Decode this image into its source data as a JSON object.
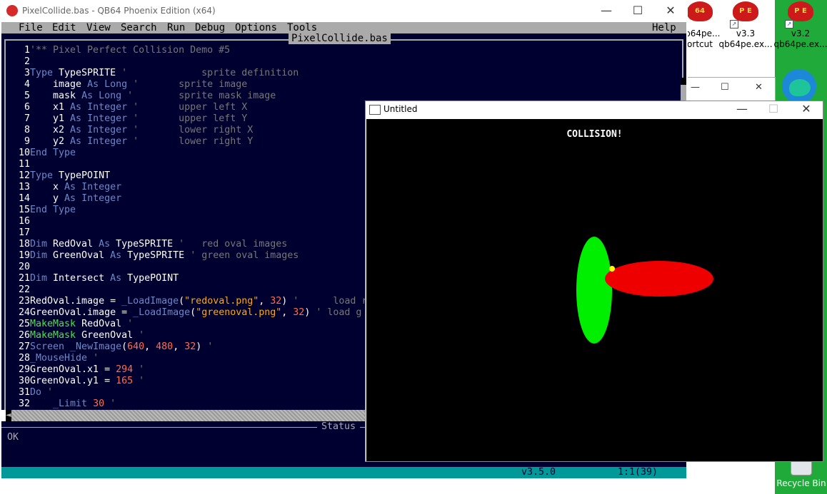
{
  "desktop": {
    "icons": [
      {
        "label_line1": "qb64pe...",
        "label_line2": "ortcut",
        "logo_text": "64"
      },
      {
        "label_line1": "v3.3",
        "label_line2": "qb64pe.ex...",
        "logo_text": "P E"
      },
      {
        "label_line1": "v3.2",
        "label_line2": "qb64pe.ex...",
        "logo_text": "P E"
      }
    ],
    "recycle_bin_label": "Recycle Bin"
  },
  "ide": {
    "window_title": "PixelCollide.bas - QB64 Phoenix Edition (x64)",
    "controls": {
      "minimize": "—",
      "maximize": "☐",
      "close": "✕"
    },
    "menu": [
      "File",
      "Edit",
      "View",
      "Search",
      "Run",
      "Debug",
      "Options",
      "Tools"
    ],
    "menu_help": "Help",
    "file_tab": "PixelCollide.bas",
    "status_label": "Status",
    "status_text": "OK",
    "version": "v3.5.0",
    "cursor_pos": "1:1(39)"
  },
  "code_lines": [
    [
      {
        "t": "'** Pixel Perfect Collision Demo #5",
        "c": "cm"
      }
    ],
    [],
    [
      {
        "t": "Type ",
        "c": "kw"
      },
      {
        "t": "TypeSPRITE ",
        "c": "id"
      },
      {
        "t": "'             sprite definition",
        "c": "cm"
      }
    ],
    [
      {
        "t": "    image ",
        "c": "id"
      },
      {
        "t": "As Long ",
        "c": "kw"
      },
      {
        "t": "'       sprite image",
        "c": "cm"
      }
    ],
    [
      {
        "t": "    mask ",
        "c": "id"
      },
      {
        "t": "As Long ",
        "c": "kw"
      },
      {
        "t": "'        sprite mask image",
        "c": "cm"
      }
    ],
    [
      {
        "t": "    x1 ",
        "c": "id"
      },
      {
        "t": "As Integer ",
        "c": "kw"
      },
      {
        "t": "'       upper left X",
        "c": "cm"
      }
    ],
    [
      {
        "t": "    y1 ",
        "c": "id"
      },
      {
        "t": "As Integer ",
        "c": "kw"
      },
      {
        "t": "'       upper left Y",
        "c": "cm"
      }
    ],
    [
      {
        "t": "    x2 ",
        "c": "id"
      },
      {
        "t": "As Integer ",
        "c": "kw"
      },
      {
        "t": "'       lower right X",
        "c": "cm"
      }
    ],
    [
      {
        "t": "    y2 ",
        "c": "id"
      },
      {
        "t": "As Integer ",
        "c": "kw"
      },
      {
        "t": "'       lower right Y",
        "c": "cm"
      }
    ],
    [
      {
        "t": "End Type",
        "c": "kw"
      }
    ],
    [],
    [
      {
        "t": "Type ",
        "c": "kw"
      },
      {
        "t": "TypePOINT",
        "c": "id"
      }
    ],
    [
      {
        "t": "    x ",
        "c": "id"
      },
      {
        "t": "As Integer",
        "c": "kw"
      }
    ],
    [
      {
        "t": "    y ",
        "c": "id"
      },
      {
        "t": "As Integer",
        "c": "kw"
      }
    ],
    [
      {
        "t": "End Type",
        "c": "kw"
      }
    ],
    [],
    [],
    [
      {
        "t": "Dim ",
        "c": "kw"
      },
      {
        "t": "RedOval ",
        "c": "id"
      },
      {
        "t": "As ",
        "c": "kw"
      },
      {
        "t": "TypeSPRITE ",
        "c": "id"
      },
      {
        "t": "'   red oval images",
        "c": "cm"
      }
    ],
    [
      {
        "t": "Dim ",
        "c": "kw"
      },
      {
        "t": "GreenOval ",
        "c": "id"
      },
      {
        "t": "As ",
        "c": "kw"
      },
      {
        "t": "TypeSPRITE ",
        "c": "id"
      },
      {
        "t": "' green oval images",
        "c": "cm"
      }
    ],
    [],
    [
      {
        "t": "Dim ",
        "c": "kw"
      },
      {
        "t": "Intersect ",
        "c": "id"
      },
      {
        "t": "As ",
        "c": "kw"
      },
      {
        "t": "TypePOINT",
        "c": "id"
      }
    ],
    [],
    [
      {
        "t": "RedOval.image = ",
        "c": "id"
      },
      {
        "t": "_LoadImage",
        "c": "kw"
      },
      {
        "t": "(",
        "c": "id"
      },
      {
        "t": "\"redoval.png\"",
        "c": "str"
      },
      {
        "t": ", ",
        "c": "id"
      },
      {
        "t": "32",
        "c": "nm"
      },
      {
        "t": ") ",
        "c": "id"
      },
      {
        "t": "'      load r",
        "c": "cm"
      }
    ],
    [
      {
        "t": "GreenOval.image = ",
        "c": "id"
      },
      {
        "t": "_LoadImage",
        "c": "kw"
      },
      {
        "t": "(",
        "c": "id"
      },
      {
        "t": "\"greenoval.png\"",
        "c": "str"
      },
      {
        "t": ", ",
        "c": "id"
      },
      {
        "t": "32",
        "c": "nm"
      },
      {
        "t": ") ",
        "c": "id"
      },
      {
        "t": "' load g",
        "c": "cm"
      }
    ],
    [
      {
        "t": "MakeMask ",
        "c": "kw2"
      },
      {
        "t": "RedOval ",
        "c": "id"
      },
      {
        "t": "'",
        "c": "cm"
      }
    ],
    [
      {
        "t": "MakeMask ",
        "c": "kw2"
      },
      {
        "t": "GreenOval ",
        "c": "id"
      },
      {
        "t": "'",
        "c": "cm"
      }
    ],
    [
      {
        "t": "Screen ",
        "c": "kw"
      },
      {
        "t": "_NewImage",
        "c": "kw"
      },
      {
        "t": "(",
        "c": "id"
      },
      {
        "t": "640",
        "c": "nm"
      },
      {
        "t": ", ",
        "c": "id"
      },
      {
        "t": "480",
        "c": "nm"
      },
      {
        "t": ", ",
        "c": "id"
      },
      {
        "t": "32",
        "c": "nm"
      },
      {
        "t": ") ",
        "c": "id"
      },
      {
        "t": "'",
        "c": "cm"
      }
    ],
    [
      {
        "t": "_MouseHide ",
        "c": "kw"
      },
      {
        "t": "'",
        "c": "cm"
      }
    ],
    [
      {
        "t": "GreenOval.x1 = ",
        "c": "id"
      },
      {
        "t": "294 ",
        "c": "nm"
      },
      {
        "t": "'",
        "c": "cm"
      }
    ],
    [
      {
        "t": "GreenOval.y1 = ",
        "c": "id"
      },
      {
        "t": "165 ",
        "c": "nm"
      },
      {
        "t": "'",
        "c": "cm"
      }
    ],
    [
      {
        "t": "Do ",
        "c": "kw"
      },
      {
        "t": "'",
        "c": "cm"
      }
    ],
    [
      {
        "t": "    _Limit ",
        "c": "kw"
      },
      {
        "t": "30 ",
        "c": "nm"
      },
      {
        "t": "'",
        "c": "cm"
      }
    ]
  ],
  "program": {
    "window_title": "Untitled",
    "controls": {
      "minimize": "—",
      "maximize": "☐",
      "close": "✕"
    },
    "message": "COLLISION!"
  },
  "back_window": {
    "controls": {
      "minimize": "—",
      "maximize": "☐",
      "close": "✕"
    }
  }
}
